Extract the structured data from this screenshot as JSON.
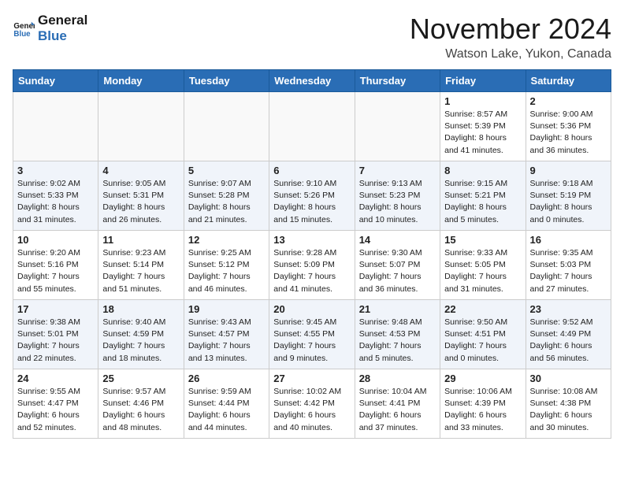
{
  "header": {
    "logo_line1": "General",
    "logo_line2": "Blue",
    "month": "November 2024",
    "location": "Watson Lake, Yukon, Canada"
  },
  "days_of_week": [
    "Sunday",
    "Monday",
    "Tuesday",
    "Wednesday",
    "Thursday",
    "Friday",
    "Saturday"
  ],
  "weeks": [
    [
      {
        "day": "",
        "info": ""
      },
      {
        "day": "",
        "info": ""
      },
      {
        "day": "",
        "info": ""
      },
      {
        "day": "",
        "info": ""
      },
      {
        "day": "",
        "info": ""
      },
      {
        "day": "1",
        "info": "Sunrise: 8:57 AM\nSunset: 5:39 PM\nDaylight: 8 hours\nand 41 minutes."
      },
      {
        "day": "2",
        "info": "Sunrise: 9:00 AM\nSunset: 5:36 PM\nDaylight: 8 hours\nand 36 minutes."
      }
    ],
    [
      {
        "day": "3",
        "info": "Sunrise: 9:02 AM\nSunset: 5:33 PM\nDaylight: 8 hours\nand 31 minutes."
      },
      {
        "day": "4",
        "info": "Sunrise: 9:05 AM\nSunset: 5:31 PM\nDaylight: 8 hours\nand 26 minutes."
      },
      {
        "day": "5",
        "info": "Sunrise: 9:07 AM\nSunset: 5:28 PM\nDaylight: 8 hours\nand 21 minutes."
      },
      {
        "day": "6",
        "info": "Sunrise: 9:10 AM\nSunset: 5:26 PM\nDaylight: 8 hours\nand 15 minutes."
      },
      {
        "day": "7",
        "info": "Sunrise: 9:13 AM\nSunset: 5:23 PM\nDaylight: 8 hours\nand 10 minutes."
      },
      {
        "day": "8",
        "info": "Sunrise: 9:15 AM\nSunset: 5:21 PM\nDaylight: 8 hours\nand 5 minutes."
      },
      {
        "day": "9",
        "info": "Sunrise: 9:18 AM\nSunset: 5:19 PM\nDaylight: 8 hours\nand 0 minutes."
      }
    ],
    [
      {
        "day": "10",
        "info": "Sunrise: 9:20 AM\nSunset: 5:16 PM\nDaylight: 7 hours\nand 55 minutes."
      },
      {
        "day": "11",
        "info": "Sunrise: 9:23 AM\nSunset: 5:14 PM\nDaylight: 7 hours\nand 51 minutes."
      },
      {
        "day": "12",
        "info": "Sunrise: 9:25 AM\nSunset: 5:12 PM\nDaylight: 7 hours\nand 46 minutes."
      },
      {
        "day": "13",
        "info": "Sunrise: 9:28 AM\nSunset: 5:09 PM\nDaylight: 7 hours\nand 41 minutes."
      },
      {
        "day": "14",
        "info": "Sunrise: 9:30 AM\nSunset: 5:07 PM\nDaylight: 7 hours\nand 36 minutes."
      },
      {
        "day": "15",
        "info": "Sunrise: 9:33 AM\nSunset: 5:05 PM\nDaylight: 7 hours\nand 31 minutes."
      },
      {
        "day": "16",
        "info": "Sunrise: 9:35 AM\nSunset: 5:03 PM\nDaylight: 7 hours\nand 27 minutes."
      }
    ],
    [
      {
        "day": "17",
        "info": "Sunrise: 9:38 AM\nSunset: 5:01 PM\nDaylight: 7 hours\nand 22 minutes."
      },
      {
        "day": "18",
        "info": "Sunrise: 9:40 AM\nSunset: 4:59 PM\nDaylight: 7 hours\nand 18 minutes."
      },
      {
        "day": "19",
        "info": "Sunrise: 9:43 AM\nSunset: 4:57 PM\nDaylight: 7 hours\nand 13 minutes."
      },
      {
        "day": "20",
        "info": "Sunrise: 9:45 AM\nSunset: 4:55 PM\nDaylight: 7 hours\nand 9 minutes."
      },
      {
        "day": "21",
        "info": "Sunrise: 9:48 AM\nSunset: 4:53 PM\nDaylight: 7 hours\nand 5 minutes."
      },
      {
        "day": "22",
        "info": "Sunrise: 9:50 AM\nSunset: 4:51 PM\nDaylight: 7 hours\nand 0 minutes."
      },
      {
        "day": "23",
        "info": "Sunrise: 9:52 AM\nSunset: 4:49 PM\nDaylight: 6 hours\nand 56 minutes."
      }
    ],
    [
      {
        "day": "24",
        "info": "Sunrise: 9:55 AM\nSunset: 4:47 PM\nDaylight: 6 hours\nand 52 minutes."
      },
      {
        "day": "25",
        "info": "Sunrise: 9:57 AM\nSunset: 4:46 PM\nDaylight: 6 hours\nand 48 minutes."
      },
      {
        "day": "26",
        "info": "Sunrise: 9:59 AM\nSunset: 4:44 PM\nDaylight: 6 hours\nand 44 minutes."
      },
      {
        "day": "27",
        "info": "Sunrise: 10:02 AM\nSunset: 4:42 PM\nDaylight: 6 hours\nand 40 minutes."
      },
      {
        "day": "28",
        "info": "Sunrise: 10:04 AM\nSunset: 4:41 PM\nDaylight: 6 hours\nand 37 minutes."
      },
      {
        "day": "29",
        "info": "Sunrise: 10:06 AM\nSunset: 4:39 PM\nDaylight: 6 hours\nand 33 minutes."
      },
      {
        "day": "30",
        "info": "Sunrise: 10:08 AM\nSunset: 4:38 PM\nDaylight: 6 hours\nand 30 minutes."
      }
    ]
  ]
}
